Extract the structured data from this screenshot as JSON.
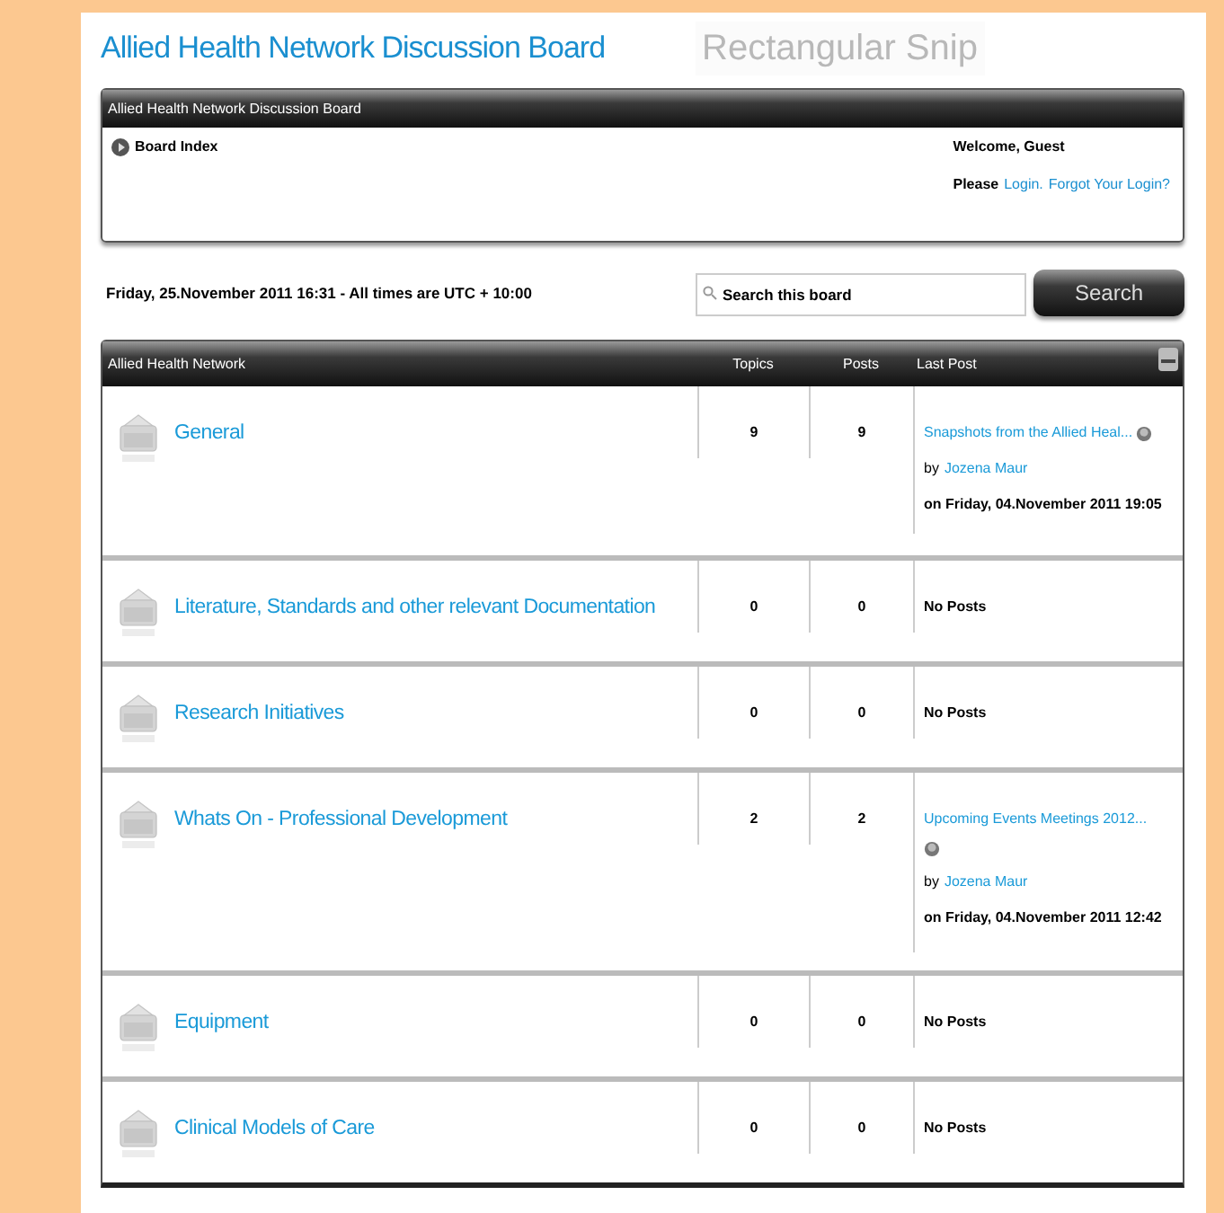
{
  "title": "Allied Health Network Discussion Board",
  "overlay_label": "Rectangular Snip",
  "header_box": {
    "title": "Allied Health Network Discussion Board",
    "breadcrumb": "Board Index",
    "welcome": "Welcome, Guest",
    "login_prompt": "Please",
    "login_link": "Login.",
    "forgot_link": "Forgot Your Login?"
  },
  "date_line": "Friday, 25.November 2011 16:31 - All times are UTC + 10:00",
  "search": {
    "placeholder": "Search this board",
    "button": "Search"
  },
  "table": {
    "columns": [
      "Allied Health Network",
      "Topics",
      "Posts",
      "Last Post"
    ],
    "rows": [
      {
        "name": "General",
        "topics": "9",
        "posts": "9",
        "last_post": {
          "title": "Snapshots from the Allied Heal...",
          "icon_inline": true,
          "by": "by",
          "author": "Jozena Maur",
          "date": "on Friday, 04.November 2011 19:05"
        }
      },
      {
        "name": "Literature, Standards and other relevant Documentation",
        "topics": "0",
        "posts": "0",
        "no_posts": "No Posts"
      },
      {
        "name": "Research Initiatives",
        "topics": "0",
        "posts": "0",
        "no_posts": "No Posts"
      },
      {
        "name": "Whats On - Professional Development",
        "topics": "2",
        "posts": "2",
        "last_post": {
          "title": "Upcoming Events Meetings 2012...",
          "icon_inline": false,
          "by": "by",
          "author": "Jozena Maur",
          "date": "on Friday, 04.November 2011 12:42"
        }
      },
      {
        "name": "Equipment",
        "topics": "0",
        "posts": "0",
        "no_posts": "No Posts"
      },
      {
        "name": "Clinical Models of Care",
        "topics": "0",
        "posts": "0",
        "no_posts": "No Posts"
      }
    ]
  }
}
